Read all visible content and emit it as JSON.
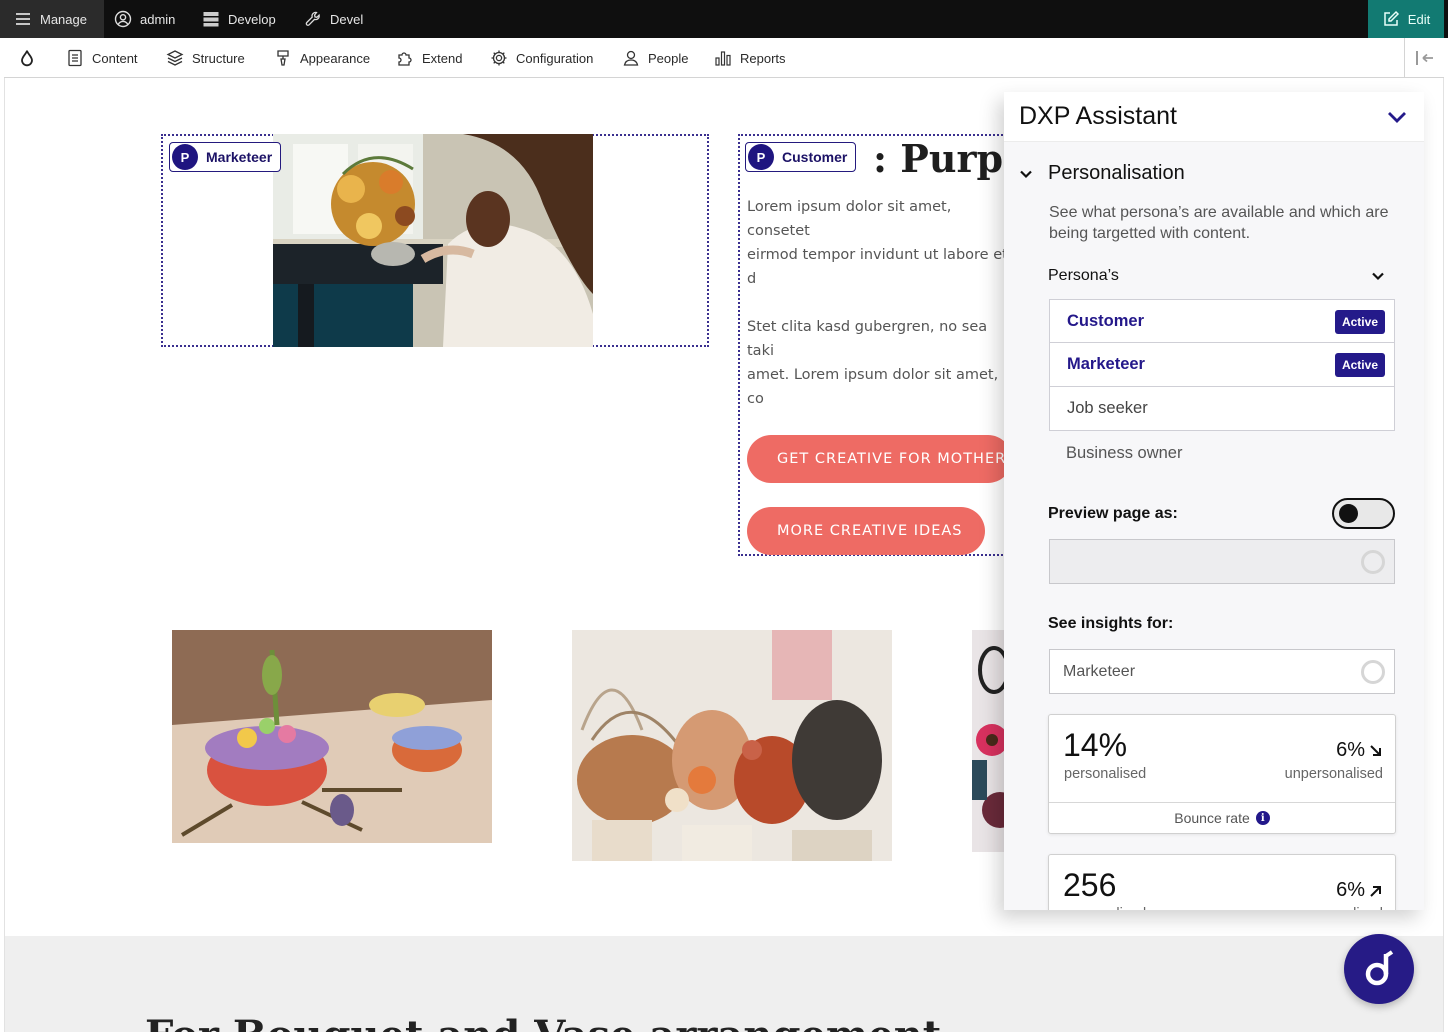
{
  "toolbar": {
    "manage": "Manage",
    "admin": "admin",
    "develop": "Develop",
    "devel": "Devel",
    "edit": "Edit"
  },
  "tray": {
    "items": [
      "Content",
      "Structure",
      "Appearance",
      "Extend",
      "Configuration",
      "People",
      "Reports"
    ]
  },
  "content": {
    "persona_tag_a": "Marketeer",
    "persona_tag_b": "Customer",
    "headline": ": Purple r",
    "paragraph_1": "Lorem ipsum dolor sit amet, consetet\neirmod tempor invidunt ut labore et d\nvoluptua. At vero eos et accusam et j\ndolor sit amet, consetetur sadipscing",
    "paragraph_2": "Stet clita kasd gubergren, no sea taki\namet. Lorem ipsum dolor sit amet, co\neirmod tempor invidunt ut labore et d\nvoluptua.",
    "cta_primary": "GET CREATIVE FOR MOTHERS",
    "cta_secondary": "MORE CREATIVE IDEAS",
    "footer_heading": "For Bouquet and Vase arrangement"
  },
  "assistant": {
    "title": "DXP Assistant",
    "section_title": "Personalisation",
    "section_description": "See what persona’s are available and which are being targetted with content.",
    "personas_label": "Persona’s",
    "personas": [
      {
        "name": "Customer",
        "status": "Active"
      },
      {
        "name": "Marketeer",
        "status": "Active"
      },
      {
        "name": "Job seeker",
        "status": ""
      },
      {
        "name": "Business owner",
        "status": ""
      }
    ],
    "preview_label": "Preview page as:",
    "preview_toggle_on": false,
    "preview_select_value": "",
    "insights_label": "See insights for:",
    "insights_value": "Marketeer",
    "metrics": [
      {
        "value": "14%",
        "value_label": "personalised",
        "compare": "6%",
        "compare_label": "unpersonalised",
        "trend": "down",
        "footer": "Bounce rate"
      },
      {
        "value": "256",
        "value_label": "personalised",
        "compare": "6%",
        "compare_label": "unpersonalised",
        "trend": "up",
        "footer": ""
      }
    ]
  },
  "colors": {
    "toolbar_bg": "#0f0f0f",
    "edit_bg": "#127a72",
    "brand_purple": "#241a8a",
    "cta_coral": "#ee6b64"
  }
}
